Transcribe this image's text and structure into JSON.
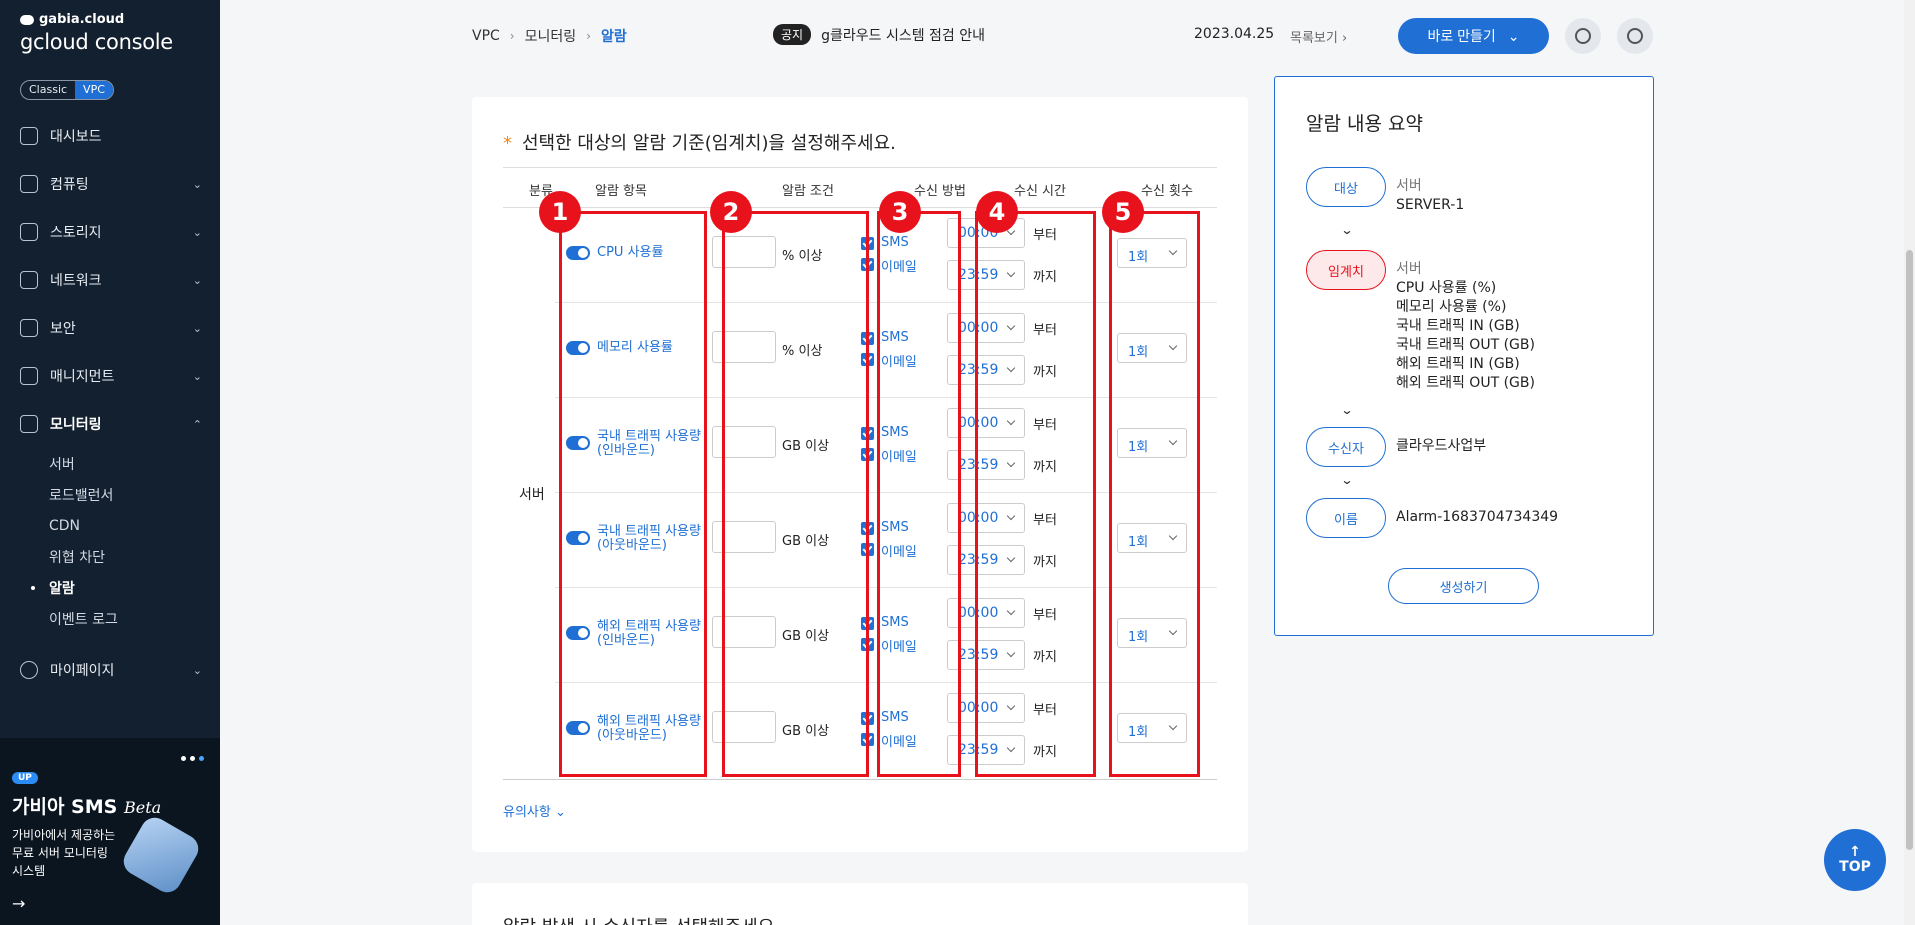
{
  "brand": {
    "small": "gabia.cloud",
    "big": "gcloud console"
  },
  "env_toggle": {
    "classic": "Classic",
    "vpc": "VPC"
  },
  "sidebar": {
    "items": [
      {
        "label": "대시보드",
        "icon": "dashboard-icon"
      },
      {
        "label": "컴퓨팅",
        "icon": "compute-icon"
      },
      {
        "label": "스토리지",
        "icon": "storage-icon"
      },
      {
        "label": "네트워크",
        "icon": "network-icon"
      },
      {
        "label": "보안",
        "icon": "shield-icon"
      },
      {
        "label": "매니지먼트",
        "icon": "management-icon"
      },
      {
        "label": "모니터링",
        "icon": "monitoring-icon"
      }
    ],
    "sub_items": [
      "서버",
      "로드밸런서",
      "CDN",
      "위협 차단",
      "알람",
      "이벤트 로그"
    ],
    "mypage": "마이페이지"
  },
  "promo": {
    "badge": "UP",
    "title": "가비아 SMS",
    "title_em": "Beta",
    "desc": "가비아에서 제공하는 무료 서버 모니터링 시스템"
  },
  "breadcrumb": {
    "b1": "VPC",
    "b2": "모니터링",
    "b3": "알람"
  },
  "notice": {
    "tag": "공지",
    "text": "g클라우드 시스템 점검 안내",
    "date": "2023.04.25",
    "list": "목록보기"
  },
  "header": {
    "create_label": "바로 만들기"
  },
  "card": {
    "title": "선택한 대상의 알람 기준(임계치)을 설정해주세요.",
    "req": "*",
    "headers": {
      "category": "분류",
      "item": "알람 항목",
      "condition": "알람 조건",
      "method": "수신 방법",
      "time": "수신 시간",
      "count": "수신 횟수"
    },
    "group": "서버",
    "notes": "유의사항",
    "next_title": "알람 발생 시 수신자를 선택해주세요."
  },
  "common": {
    "sms": "SMS",
    "email": "이메일",
    "from": "부터",
    "to": "까지"
  },
  "rows": [
    {
      "name": "CPU 사용률",
      "unit": "% 이상",
      "start": "00:00",
      "end": "23:59",
      "count": "1회"
    },
    {
      "name": "메모리 사용률",
      "unit": "% 이상",
      "start": "00:00",
      "end": "23:59",
      "count": "1회"
    },
    {
      "name": "국내 트래픽 사용량(인바운드)",
      "unit": "GB 이상",
      "start": "00:00",
      "end": "23:59",
      "count": "1회"
    },
    {
      "name": "국내 트래픽 사용량(아웃바운드)",
      "unit": "GB 이상",
      "start": "00:00",
      "end": "23:59",
      "count": "1회"
    },
    {
      "name": "해외 트래픽 사용량(인바운드)",
      "unit": "GB 이상",
      "start": "00:00",
      "end": "23:59",
      "count": "1회"
    },
    {
      "name": "해외 트래픽 사용량(아웃바운드)",
      "unit": "GB 이상",
      "start": "00:00",
      "end": "23:59",
      "count": "1회"
    }
  ],
  "badges": [
    "1",
    "2",
    "3",
    "4",
    "5"
  ],
  "summary": {
    "title": "알람 내용 요약",
    "target_pill": "대상",
    "target_type": "서버",
    "target_name": "SERVER-1",
    "threshold_pill": "임계치",
    "threshold_type": "서버",
    "thresholds": [
      "CPU 사용률 (%)",
      "메모리 사용률 (%)",
      "국내 트래픽 IN (GB)",
      "국내 트래픽 OUT (GB)",
      "해외 트래픽 IN (GB)",
      "해외 트래픽 OUT (GB)"
    ],
    "receiver_pill": "수신자",
    "receiver": "클라우드사업부",
    "name_pill": "이름",
    "name": "Alarm-1683704734349",
    "create": "생성하기"
  },
  "top_label": "TOP",
  "colors": {
    "primary": "#1f6fd4",
    "highlight": "#e8121d",
    "sidebar": "#13202f"
  }
}
